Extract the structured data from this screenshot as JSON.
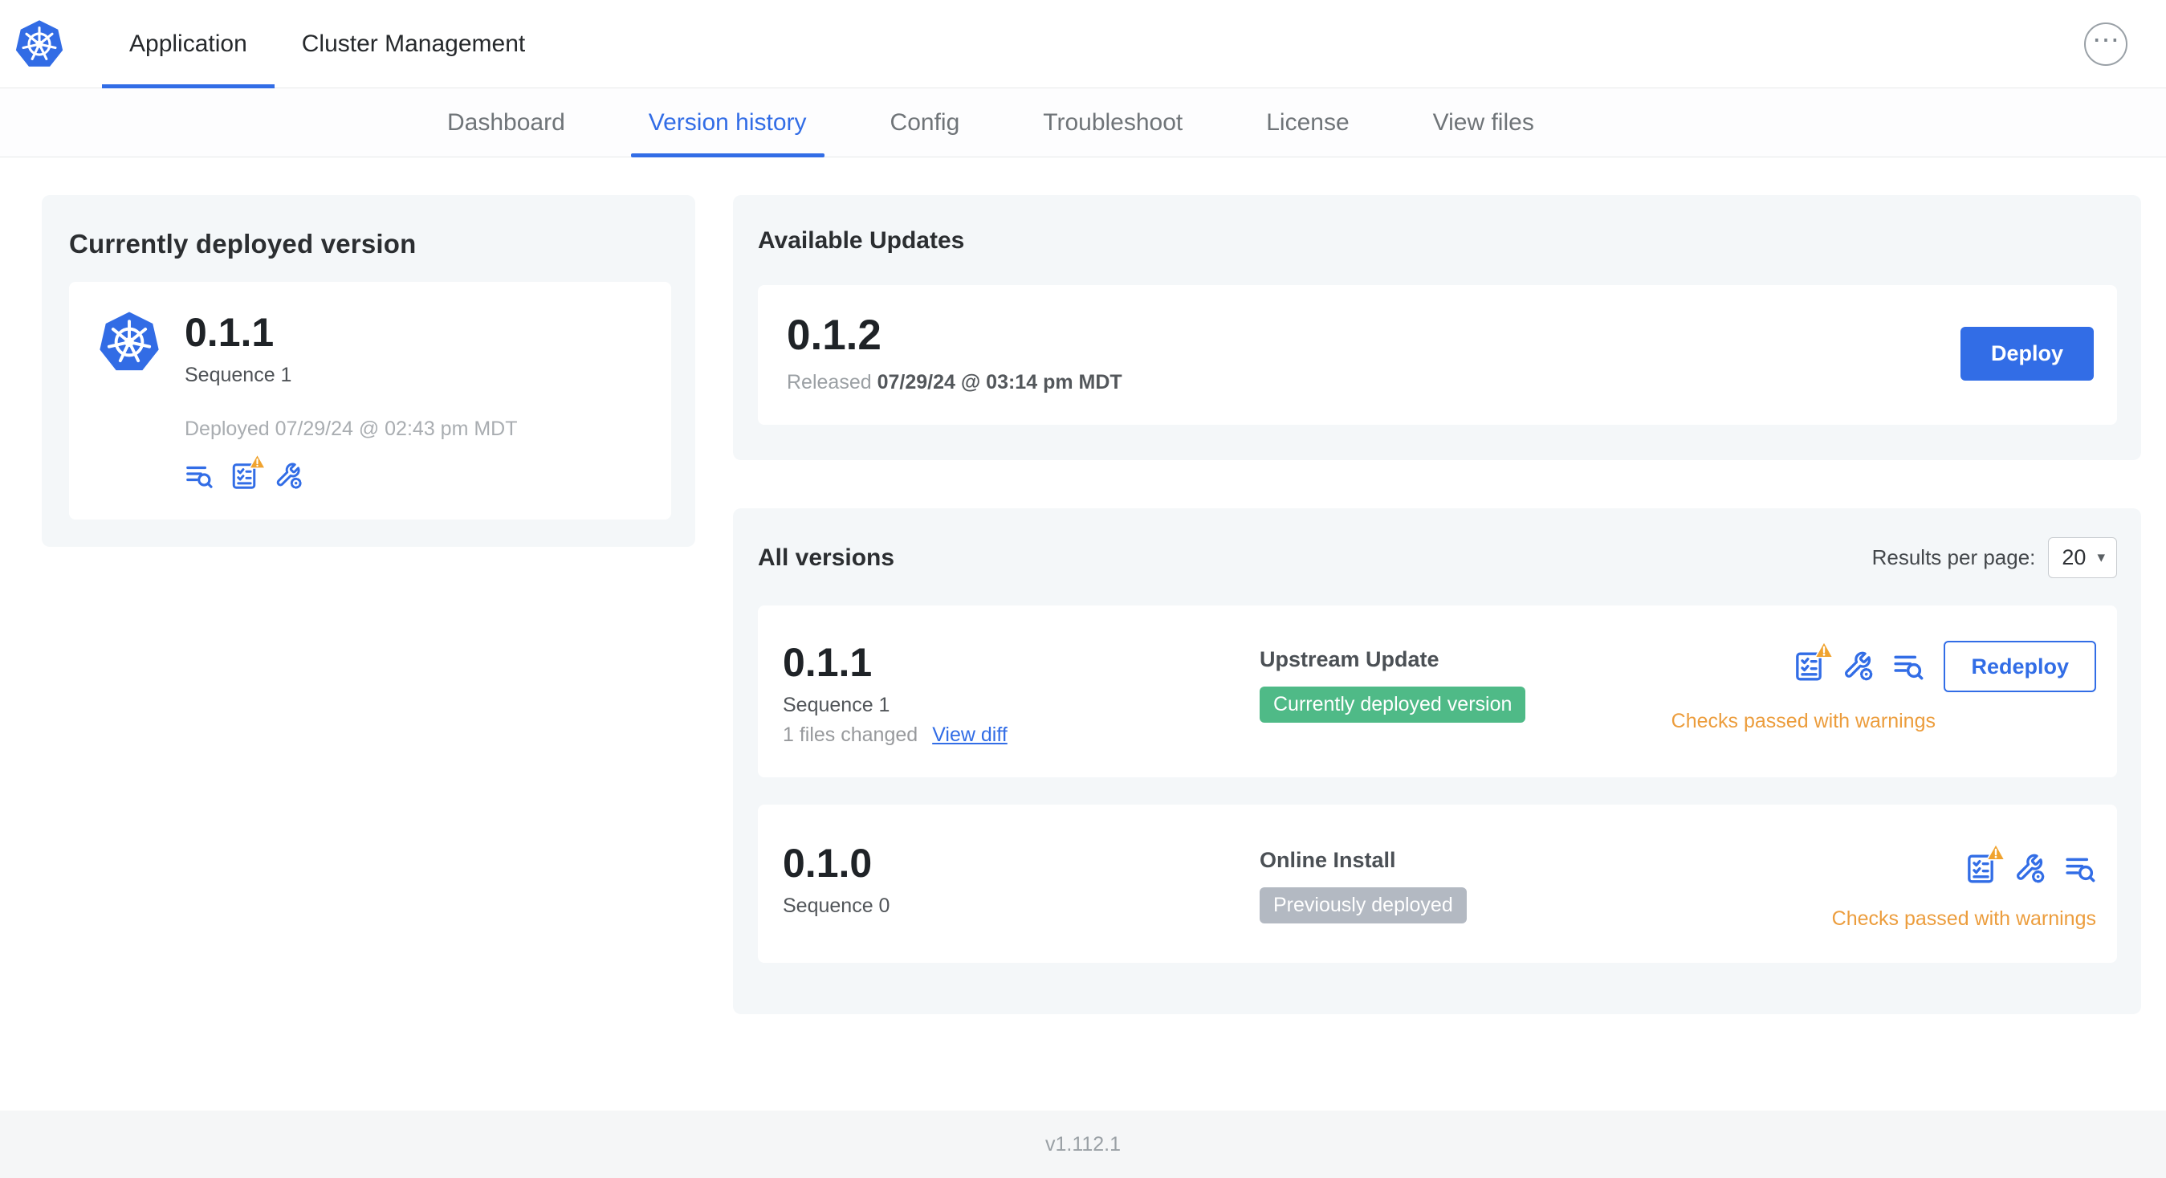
{
  "topnav": {
    "tabs": [
      {
        "label": "Application"
      },
      {
        "label": "Cluster Management"
      }
    ],
    "overflow_icon": "⋯"
  },
  "subnav": {
    "items": [
      "Dashboard",
      "Version history",
      "Config",
      "Troubleshoot",
      "License",
      "View files"
    ],
    "active_item": "Version history"
  },
  "current_version": {
    "title": "Currently deployed version",
    "version": "0.1.1",
    "sequence": "Sequence 1",
    "deployed": "Deployed 07/29/24 @ 02:43 pm MDT"
  },
  "available_updates": {
    "title": "Available Updates",
    "version": "0.1.2",
    "released_prefix": "Released",
    "released_date": "07/29/24 @ 03:14 pm MDT",
    "deploy_label": "Deploy"
  },
  "all_versions": {
    "title": "All versions",
    "results_per_page_label": "Results per page:",
    "results_per_page_value": "20",
    "select_chevron": "▾",
    "rows": [
      {
        "version": "0.1.1",
        "sequence": "Sequence 1",
        "files_changed": "1 files changed",
        "view_diff_label": "View diff",
        "source": "Upstream Update",
        "badge": "Currently deployed version",
        "badge_color": "#4fba87",
        "action_label": "Redeploy",
        "checks": "Checks passed with warnings"
      },
      {
        "version": "0.1.0",
        "sequence": "Sequence 0",
        "source": "Online Install",
        "badge": "Previously deployed",
        "badge_color": "#b3b9c2",
        "checks": "Checks passed with warnings"
      }
    ]
  },
  "footer": {
    "app_version": "v1.112.1"
  },
  "colors": {
    "primary_blue": "#326de6",
    "k8s_blue": "#326ce5",
    "warning_orange": "#ec9d3d",
    "badge_green": "#4fba87",
    "badge_gray": "#b3b9c2"
  }
}
